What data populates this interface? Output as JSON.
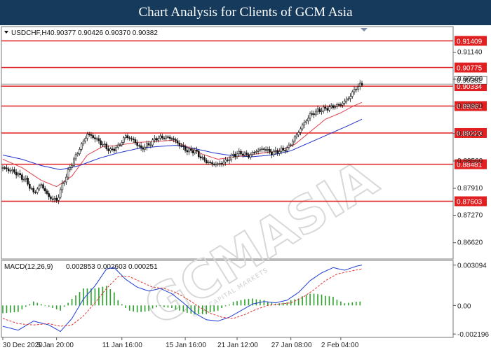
{
  "banner": {
    "title": "Chart Analysis for Clients of GCM Asia"
  },
  "header": {
    "symbol": "USDCHF,H4",
    "ohlc": "0.90377 0.90426 0.90370 0.90382"
  },
  "colors": {
    "support_resistance": "#e02020",
    "candle": "#111111",
    "ma_fast": "#e0404a",
    "ma_slow": "#2233cc",
    "macd_line": "#1f3fd6",
    "signal_line": "#e03030",
    "histogram": "#2aa02a",
    "banner": "#153a5c"
  },
  "watermark": {
    "brand": "GCMASIA",
    "tagline": "GCM CAPITAL MARKETS"
  },
  "chart_data": [
    {
      "type": "candlestick",
      "title": "USDCHF,H4",
      "ylim": [
        0.8625,
        0.9173
      ],
      "y_ticks": [
        "0.91140",
        "0.90500",
        "0.89860",
        "0.89210",
        "0.88560",
        "0.87910",
        "0.87270",
        "0.86620"
      ],
      "x_ticks": [
        "30 Dec 2020",
        "5 Jan 20:00",
        "11 Jan 16:00",
        "15 Jan 16:00",
        "21 Jan 12:00",
        "27 Jan 08:00",
        "2 Feb 04:00"
      ],
      "levels": [
        {
          "label": "0.91409",
          "value": 0.91409
        },
        {
          "label": "0.90775",
          "value": 0.90775
        },
        {
          "label": "0.90334",
          "value": 0.90334
        },
        {
          "label": "0.89861",
          "value": 0.89861
        },
        {
          "label": "0.89223",
          "value": 0.89223
        },
        {
          "label": "0.88481",
          "value": 0.88481
        },
        {
          "label": "0.87603",
          "value": 0.87603
        }
      ],
      "current_price": {
        "label": "0.90382",
        "value": 0.90382
      },
      "path": [
        [
          0,
          0.884
        ],
        [
          6,
          0.883
        ],
        [
          12,
          0.881
        ],
        [
          16,
          0.878
        ],
        [
          20,
          0.88
        ],
        [
          24,
          0.877
        ],
        [
          28,
          0.8762
        ],
        [
          32,
          0.881
        ],
        [
          36,
          0.885
        ],
        [
          40,
          0.8885
        ],
        [
          44,
          0.892
        ],
        [
          48,
          0.891
        ],
        [
          52,
          0.8895
        ],
        [
          56,
          0.888
        ],
        [
          60,
          0.889
        ],
        [
          64,
          0.8915
        ],
        [
          68,
          0.8905
        ],
        [
          72,
          0.8885
        ],
        [
          76,
          0.8895
        ],
        [
          80,
          0.891
        ],
        [
          84,
          0.8912
        ],
        [
          88,
          0.891
        ],
        [
          92,
          0.8895
        ],
        [
          96,
          0.888
        ],
        [
          100,
          0.888
        ],
        [
          104,
          0.886
        ],
        [
          108,
          0.885
        ],
        [
          112,
          0.8848
        ],
        [
          116,
          0.8855
        ],
        [
          120,
          0.887
        ],
        [
          124,
          0.8875
        ],
        [
          128,
          0.8868
        ],
        [
          132,
          0.888
        ],
        [
          136,
          0.8885
        ],
        [
          140,
          0.8875
        ],
        [
          144,
          0.888
        ],
        [
          148,
          0.8885
        ],
        [
          152,
          0.891
        ],
        [
          156,
          0.894
        ],
        [
          160,
          0.8965
        ],
        [
          164,
          0.8975
        ],
        [
          168,
          0.898
        ],
        [
          172,
          0.8985
        ],
        [
          176,
          0.899
        ],
        [
          180,
          0.9005
        ],
        [
          184,
          0.903
        ],
        [
          187,
          0.9038
        ]
      ],
      "ma_fast": [
        [
          0,
          0.886
        ],
        [
          10,
          0.884
        ],
        [
          20,
          0.881
        ],
        [
          28,
          0.8795
        ],
        [
          36,
          0.882
        ],
        [
          44,
          0.887
        ],
        [
          52,
          0.889
        ],
        [
          60,
          0.8893
        ],
        [
          70,
          0.89
        ],
        [
          80,
          0.8902
        ],
        [
          88,
          0.8905
        ],
        [
          96,
          0.889
        ],
        [
          104,
          0.8872
        ],
        [
          112,
          0.886
        ],
        [
          120,
          0.8865
        ],
        [
          128,
          0.887
        ],
        [
          136,
          0.8875
        ],
        [
          144,
          0.888
        ],
        [
          152,
          0.8895
        ],
        [
          160,
          0.8925
        ],
        [
          168,
          0.8955
        ],
        [
          176,
          0.897
        ],
        [
          182,
          0.8985
        ],
        [
          187,
          0.8995
        ]
      ],
      "ma_slow": [
        [
          0,
          0.887
        ],
        [
          10,
          0.886
        ],
        [
          20,
          0.8845
        ],
        [
          30,
          0.8835
        ],
        [
          40,
          0.8845
        ],
        [
          50,
          0.8862
        ],
        [
          60,
          0.8875
        ],
        [
          70,
          0.8885
        ],
        [
          80,
          0.889
        ],
        [
          90,
          0.8893
        ],
        [
          100,
          0.8885
        ],
        [
          110,
          0.8875
        ],
        [
          120,
          0.8868
        ],
        [
          130,
          0.8866
        ],
        [
          140,
          0.887
        ],
        [
          150,
          0.888
        ],
        [
          160,
          0.89
        ],
        [
          170,
          0.892
        ],
        [
          180,
          0.894
        ],
        [
          187,
          0.8955
        ]
      ]
    },
    {
      "type": "macd",
      "title": "MACD(12,26,9)",
      "header_values": "0.002853 0.002603 0.000251",
      "ylim": [
        -0.0024,
        0.0034
      ],
      "y_ticks": [
        {
          "label": "0.003094",
          "value": 0.003094
        },
        {
          "label": "0.00",
          "value": 0.0
        },
        {
          "label": "-0.002196",
          "value": -0.002196
        }
      ],
      "macd": [
        [
          0,
          -0.0016
        ],
        [
          8,
          -0.0019
        ],
        [
          16,
          -0.0012
        ],
        [
          24,
          -0.0015
        ],
        [
          30,
          -0.002
        ],
        [
          36,
          -0.001
        ],
        [
          42,
          0.0005
        ],
        [
          48,
          0.0015
        ],
        [
          54,
          0.0028
        ],
        [
          58,
          0.0029
        ],
        [
          64,
          0.002
        ],
        [
          70,
          0.0014
        ],
        [
          76,
          0.0011
        ],
        [
          82,
          0.0013
        ],
        [
          88,
          0.0009
        ],
        [
          94,
          0.0002
        ],
        [
          100,
          -0.0006
        ],
        [
          106,
          -0.0011
        ],
        [
          112,
          -0.0012
        ],
        [
          118,
          -0.0009
        ],
        [
          124,
          -0.0004
        ],
        [
          130,
          0.0001
        ],
        [
          136,
          0.0003
        ],
        [
          142,
          0.0002
        ],
        [
          148,
          0.0004
        ],
        [
          154,
          0.001
        ],
        [
          160,
          0.0019
        ],
        [
          166,
          0.0025
        ],
        [
          172,
          0.0029
        ],
        [
          178,
          0.0027
        ],
        [
          184,
          0.003
        ],
        [
          187,
          0.0031
        ]
      ],
      "signal": [
        [
          0,
          -0.001
        ],
        [
          8,
          -0.0014
        ],
        [
          16,
          -0.0015
        ],
        [
          24,
          -0.0014
        ],
        [
          30,
          -0.0016
        ],
        [
          36,
          -0.0015
        ],
        [
          42,
          -0.0008
        ],
        [
          48,
          0.0002
        ],
        [
          54,
          0.0013
        ],
        [
          60,
          0.0022
        ],
        [
          66,
          0.0022
        ],
        [
          72,
          0.0018
        ],
        [
          78,
          0.0014
        ],
        [
          84,
          0.0013
        ],
        [
          90,
          0.001
        ],
        [
          96,
          0.0005
        ],
        [
          102,
          -0.0001
        ],
        [
          108,
          -0.0006
        ],
        [
          114,
          -0.0009
        ],
        [
          120,
          -0.001
        ],
        [
          126,
          -0.0007
        ],
        [
          132,
          -0.0003
        ],
        [
          138,
          0.0
        ],
        [
          144,
          0.0001
        ],
        [
          150,
          0.0002
        ],
        [
          156,
          0.0006
        ],
        [
          162,
          0.0012
        ],
        [
          168,
          0.0019
        ],
        [
          174,
          0.0024
        ],
        [
          180,
          0.0026
        ],
        [
          187,
          0.0028
        ]
      ]
    }
  ]
}
